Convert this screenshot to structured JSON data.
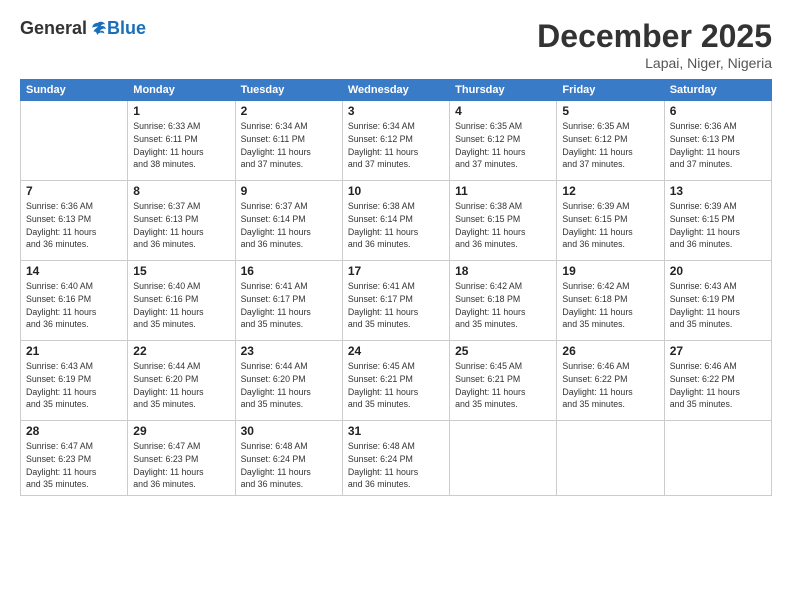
{
  "header": {
    "logo_general": "General",
    "logo_blue": "Blue",
    "month_title": "December 2025",
    "location": "Lapai, Niger, Nigeria"
  },
  "calendar": {
    "headers": [
      "Sunday",
      "Monday",
      "Tuesday",
      "Wednesday",
      "Thursday",
      "Friday",
      "Saturday"
    ],
    "weeks": [
      [
        {
          "day": "",
          "info": ""
        },
        {
          "day": "1",
          "info": "Sunrise: 6:33 AM\nSunset: 6:11 PM\nDaylight: 11 hours\nand 38 minutes."
        },
        {
          "day": "2",
          "info": "Sunrise: 6:34 AM\nSunset: 6:11 PM\nDaylight: 11 hours\nand 37 minutes."
        },
        {
          "day": "3",
          "info": "Sunrise: 6:34 AM\nSunset: 6:12 PM\nDaylight: 11 hours\nand 37 minutes."
        },
        {
          "day": "4",
          "info": "Sunrise: 6:35 AM\nSunset: 6:12 PM\nDaylight: 11 hours\nand 37 minutes."
        },
        {
          "day": "5",
          "info": "Sunrise: 6:35 AM\nSunset: 6:12 PM\nDaylight: 11 hours\nand 37 minutes."
        },
        {
          "day": "6",
          "info": "Sunrise: 6:36 AM\nSunset: 6:13 PM\nDaylight: 11 hours\nand 37 minutes."
        }
      ],
      [
        {
          "day": "7",
          "info": "Sunrise: 6:36 AM\nSunset: 6:13 PM\nDaylight: 11 hours\nand 36 minutes."
        },
        {
          "day": "8",
          "info": "Sunrise: 6:37 AM\nSunset: 6:13 PM\nDaylight: 11 hours\nand 36 minutes."
        },
        {
          "day": "9",
          "info": "Sunrise: 6:37 AM\nSunset: 6:14 PM\nDaylight: 11 hours\nand 36 minutes."
        },
        {
          "day": "10",
          "info": "Sunrise: 6:38 AM\nSunset: 6:14 PM\nDaylight: 11 hours\nand 36 minutes."
        },
        {
          "day": "11",
          "info": "Sunrise: 6:38 AM\nSunset: 6:15 PM\nDaylight: 11 hours\nand 36 minutes."
        },
        {
          "day": "12",
          "info": "Sunrise: 6:39 AM\nSunset: 6:15 PM\nDaylight: 11 hours\nand 36 minutes."
        },
        {
          "day": "13",
          "info": "Sunrise: 6:39 AM\nSunset: 6:15 PM\nDaylight: 11 hours\nand 36 minutes."
        }
      ],
      [
        {
          "day": "14",
          "info": "Sunrise: 6:40 AM\nSunset: 6:16 PM\nDaylight: 11 hours\nand 36 minutes."
        },
        {
          "day": "15",
          "info": "Sunrise: 6:40 AM\nSunset: 6:16 PM\nDaylight: 11 hours\nand 35 minutes."
        },
        {
          "day": "16",
          "info": "Sunrise: 6:41 AM\nSunset: 6:17 PM\nDaylight: 11 hours\nand 35 minutes."
        },
        {
          "day": "17",
          "info": "Sunrise: 6:41 AM\nSunset: 6:17 PM\nDaylight: 11 hours\nand 35 minutes."
        },
        {
          "day": "18",
          "info": "Sunrise: 6:42 AM\nSunset: 6:18 PM\nDaylight: 11 hours\nand 35 minutes."
        },
        {
          "day": "19",
          "info": "Sunrise: 6:42 AM\nSunset: 6:18 PM\nDaylight: 11 hours\nand 35 minutes."
        },
        {
          "day": "20",
          "info": "Sunrise: 6:43 AM\nSunset: 6:19 PM\nDaylight: 11 hours\nand 35 minutes."
        }
      ],
      [
        {
          "day": "21",
          "info": "Sunrise: 6:43 AM\nSunset: 6:19 PM\nDaylight: 11 hours\nand 35 minutes."
        },
        {
          "day": "22",
          "info": "Sunrise: 6:44 AM\nSunset: 6:20 PM\nDaylight: 11 hours\nand 35 minutes."
        },
        {
          "day": "23",
          "info": "Sunrise: 6:44 AM\nSunset: 6:20 PM\nDaylight: 11 hours\nand 35 minutes."
        },
        {
          "day": "24",
          "info": "Sunrise: 6:45 AM\nSunset: 6:21 PM\nDaylight: 11 hours\nand 35 minutes."
        },
        {
          "day": "25",
          "info": "Sunrise: 6:45 AM\nSunset: 6:21 PM\nDaylight: 11 hours\nand 35 minutes."
        },
        {
          "day": "26",
          "info": "Sunrise: 6:46 AM\nSunset: 6:22 PM\nDaylight: 11 hours\nand 35 minutes."
        },
        {
          "day": "27",
          "info": "Sunrise: 6:46 AM\nSunset: 6:22 PM\nDaylight: 11 hours\nand 35 minutes."
        }
      ],
      [
        {
          "day": "28",
          "info": "Sunrise: 6:47 AM\nSunset: 6:23 PM\nDaylight: 11 hours\nand 35 minutes."
        },
        {
          "day": "29",
          "info": "Sunrise: 6:47 AM\nSunset: 6:23 PM\nDaylight: 11 hours\nand 36 minutes."
        },
        {
          "day": "30",
          "info": "Sunrise: 6:48 AM\nSunset: 6:24 PM\nDaylight: 11 hours\nand 36 minutes."
        },
        {
          "day": "31",
          "info": "Sunrise: 6:48 AM\nSunset: 6:24 PM\nDaylight: 11 hours\nand 36 minutes."
        },
        {
          "day": "",
          "info": ""
        },
        {
          "day": "",
          "info": ""
        },
        {
          "day": "",
          "info": ""
        }
      ]
    ]
  }
}
